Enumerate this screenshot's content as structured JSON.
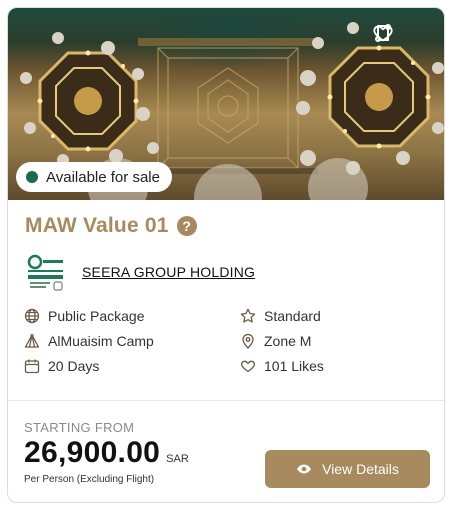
{
  "hero": {
    "badge_label": "Available for sale",
    "actions": {
      "compare_icon": "compare-arrows-icon",
      "favorite_icon": "heart-outline-icon"
    }
  },
  "package": {
    "title": "MAW Value 01",
    "help_symbol": "?"
  },
  "organizer": {
    "name": "SEERA GROUP HOLDING",
    "logo_icon": "seera-logo-icon"
  },
  "features": {
    "type": {
      "icon": "globe-icon",
      "label": "Public Package"
    },
    "tier": {
      "icon": "star-outline-icon",
      "label": "Standard"
    },
    "camp": {
      "icon": "tent-icon",
      "label": "AlMuaisim Camp"
    },
    "zone": {
      "icon": "map-pin-icon",
      "label": "Zone M"
    },
    "duration": {
      "icon": "calendar-icon",
      "label": "20 Days"
    },
    "likes": {
      "icon": "heart-icon",
      "label": "101 Likes"
    }
  },
  "pricing": {
    "starting_label": "STARTING FROM",
    "amount": "26,900.00",
    "currency": "SAR",
    "note": "Per Person (Excluding Flight)"
  },
  "cta": {
    "label": "View Details",
    "icon": "eye-icon"
  },
  "colors": {
    "accent": "#a88a5f",
    "badge_dot": "#1a6b4f",
    "text": "#111111",
    "muted": "#8a8a8a"
  }
}
